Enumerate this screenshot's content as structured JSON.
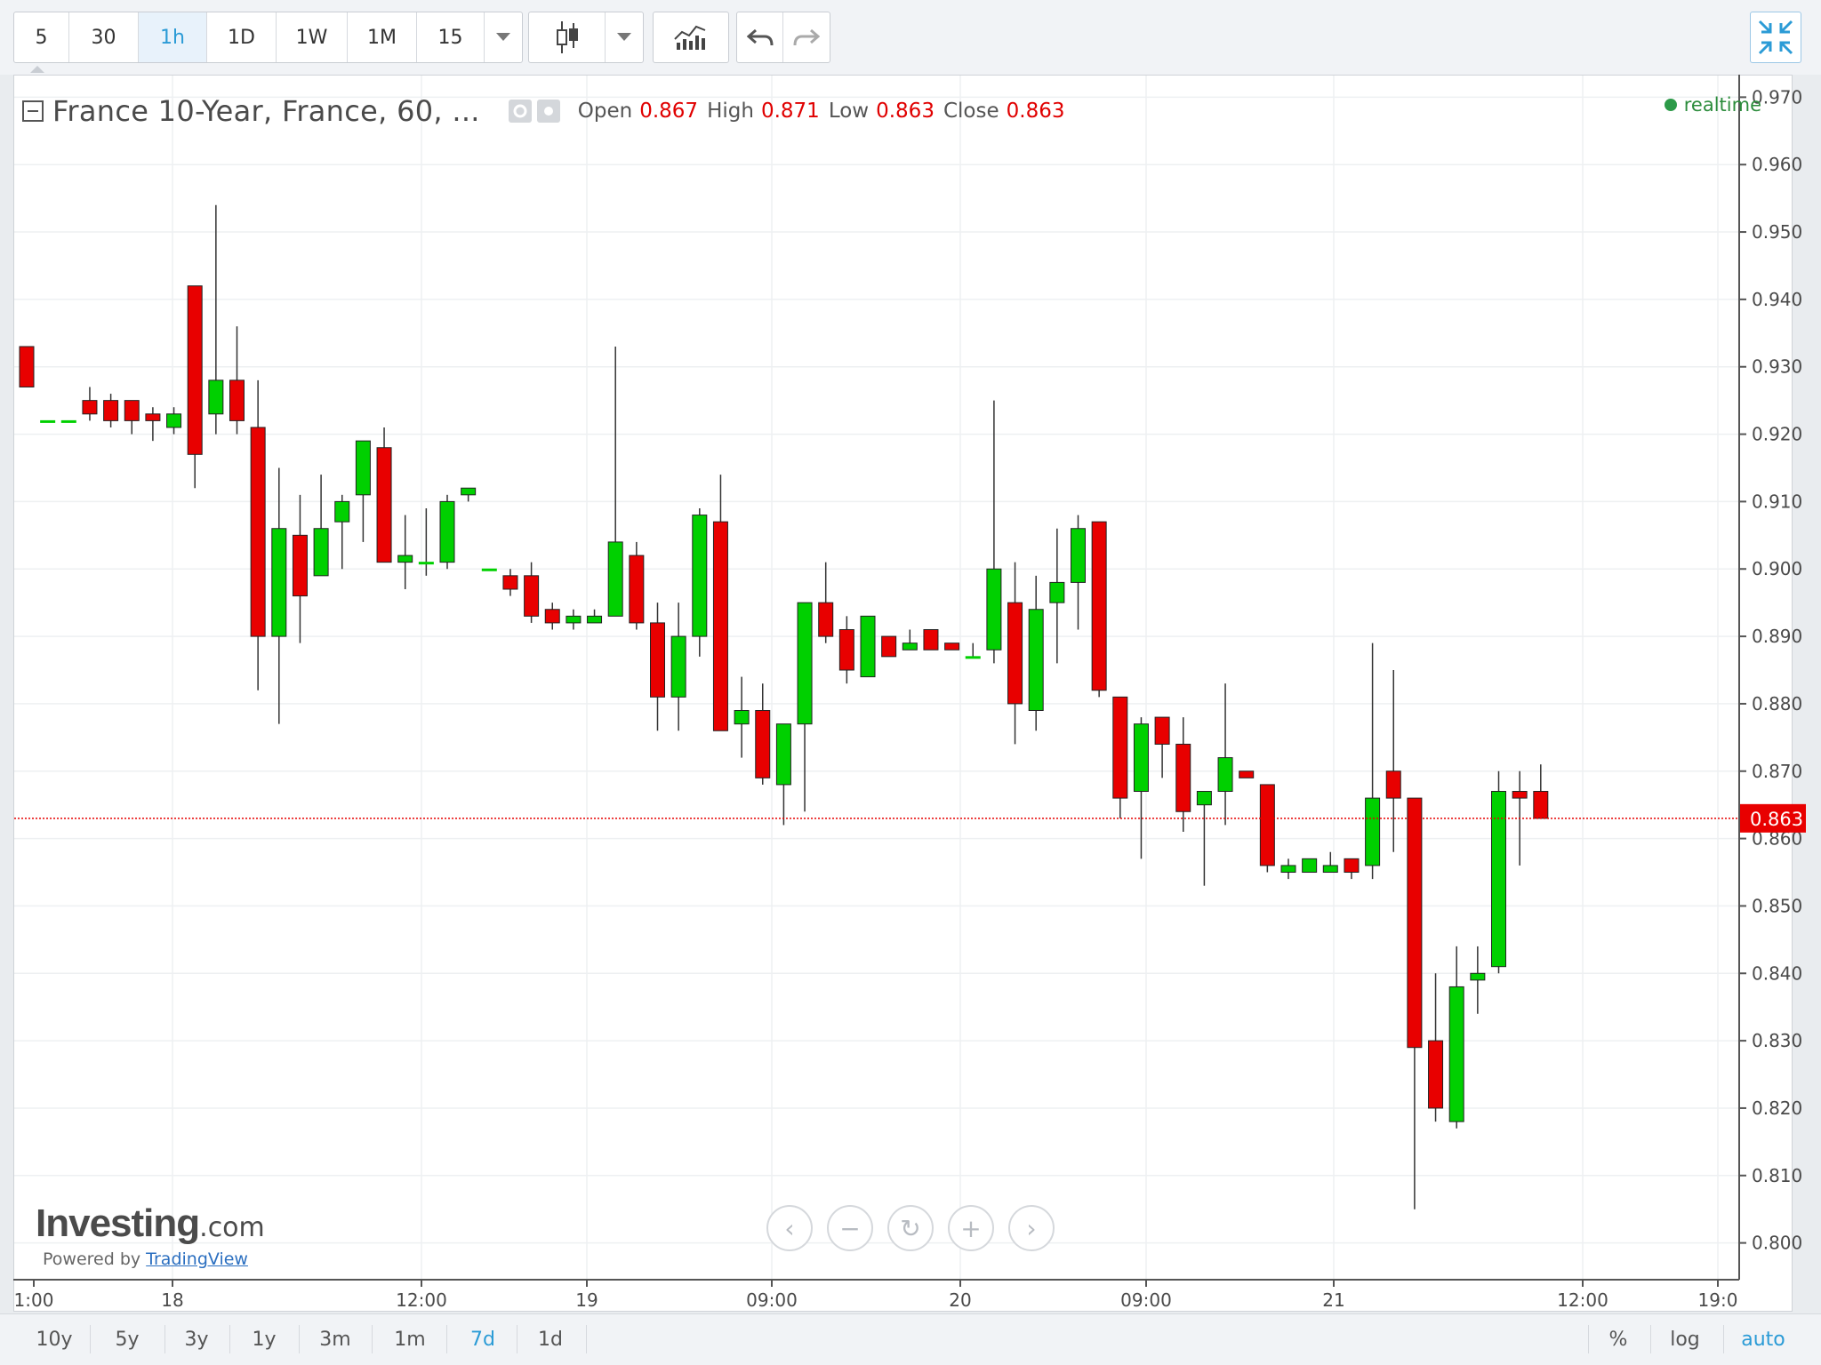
{
  "toolbar": {
    "intervals": [
      "5",
      "30",
      "1h",
      "1D",
      "1W",
      "1M",
      "15"
    ],
    "active_interval": "1h"
  },
  "header": {
    "title": "France 10-Year, France, 60, ...",
    "open_label": "Open",
    "open_value": "0.867",
    "high_label": "High",
    "high_value": "0.871",
    "low_label": "Low",
    "low_value": "0.863",
    "close_label": "Close",
    "close_value": "0.863",
    "realtime": "realtime"
  },
  "logo": {
    "brand": "Investing",
    "suffix": ".com",
    "powered_by": "Powered by",
    "powered_link": "TradingView"
  },
  "footer": {
    "ranges": [
      "10y",
      "5y",
      "3y",
      "1y",
      "3m",
      "1m",
      "7d",
      "1d"
    ],
    "active_range": "7d",
    "options": [
      "%",
      "log",
      "auto"
    ],
    "active_option": "auto"
  },
  "colors": {
    "up": "#00d000",
    "down": "#e80000",
    "last_price_line": "#e80000",
    "accent": "#2b9bd6"
  },
  "chart_data": {
    "type": "candlestick",
    "title": "France 10-Year, France, 60, ...",
    "last_price": 0.863,
    "ylim": [
      0.7975,
      0.972
    ],
    "y_ticks": [
      "0.970",
      "0.960",
      "0.950",
      "0.940",
      "0.930",
      "0.920",
      "0.910",
      "0.900",
      "0.890",
      "0.880",
      "0.870",
      "0.860",
      "0.850",
      "0.840",
      "0.830",
      "0.820",
      "0.810",
      "0.800"
    ],
    "x_ticks": [
      "1:00",
      "18",
      "12:00",
      "19",
      "09:00",
      "20",
      "09:00",
      "21",
      "12:00",
      "19:0"
    ],
    "grid": true,
    "candles": [
      {
        "o": 0.933,
        "h": 0.933,
        "l": 0.927,
        "c": 0.927
      },
      {
        "o": 0.922,
        "h": 0.922,
        "l": 0.922,
        "c": 0.922
      },
      {
        "o": 0.922,
        "h": 0.922,
        "l": 0.922,
        "c": 0.922
      },
      {
        "o": 0.925,
        "h": 0.927,
        "l": 0.922,
        "c": 0.923
      },
      {
        "o": 0.925,
        "h": 0.926,
        "l": 0.921,
        "c": 0.922
      },
      {
        "o": 0.925,
        "h": 0.925,
        "l": 0.92,
        "c": 0.922
      },
      {
        "o": 0.923,
        "h": 0.924,
        "l": 0.919,
        "c": 0.922
      },
      {
        "o": 0.921,
        "h": 0.924,
        "l": 0.92,
        "c": 0.923
      },
      {
        "o": 0.942,
        "h": 0.942,
        "l": 0.912,
        "c": 0.917
      },
      {
        "o": 0.923,
        "h": 0.954,
        "l": 0.92,
        "c": 0.928
      },
      {
        "o": 0.928,
        "h": 0.936,
        "l": 0.92,
        "c": 0.922
      },
      {
        "o": 0.921,
        "h": 0.928,
        "l": 0.882,
        "c": 0.89
      },
      {
        "o": 0.89,
        "h": 0.915,
        "l": 0.877,
        "c": 0.906
      },
      {
        "o": 0.905,
        "h": 0.911,
        "l": 0.889,
        "c": 0.896
      },
      {
        "o": 0.899,
        "h": 0.914,
        "l": 0.899,
        "c": 0.906
      },
      {
        "o": 0.907,
        "h": 0.911,
        "l": 0.9,
        "c": 0.91
      },
      {
        "o": 0.911,
        "h": 0.919,
        "l": 0.904,
        "c": 0.919
      },
      {
        "o": 0.918,
        "h": 0.921,
        "l": 0.901,
        "c": 0.901
      },
      {
        "o": 0.901,
        "h": 0.908,
        "l": 0.897,
        "c": 0.902
      },
      {
        "o": 0.901,
        "h": 0.909,
        "l": 0.899,
        "c": 0.901
      },
      {
        "o": 0.901,
        "h": 0.911,
        "l": 0.9,
        "c": 0.91
      },
      {
        "o": 0.911,
        "h": 0.912,
        "l": 0.91,
        "c": 0.912
      },
      {
        "o": 0.9,
        "h": 0.9,
        "l": 0.9,
        "c": 0.9
      },
      {
        "o": 0.899,
        "h": 0.9,
        "l": 0.896,
        "c": 0.897
      },
      {
        "o": 0.899,
        "h": 0.901,
        "l": 0.892,
        "c": 0.893
      },
      {
        "o": 0.894,
        "h": 0.895,
        "l": 0.891,
        "c": 0.892
      },
      {
        "o": 0.892,
        "h": 0.894,
        "l": 0.891,
        "c": 0.893
      },
      {
        "o": 0.892,
        "h": 0.894,
        "l": 0.892,
        "c": 0.893
      },
      {
        "o": 0.893,
        "h": 0.933,
        "l": 0.893,
        "c": 0.904
      },
      {
        "o": 0.902,
        "h": 0.904,
        "l": 0.891,
        "c": 0.892
      },
      {
        "o": 0.892,
        "h": 0.895,
        "l": 0.876,
        "c": 0.881
      },
      {
        "o": 0.881,
        "h": 0.895,
        "l": 0.876,
        "c": 0.89
      },
      {
        "o": 0.89,
        "h": 0.909,
        "l": 0.887,
        "c": 0.908
      },
      {
        "o": 0.907,
        "h": 0.914,
        "l": 0.876,
        "c": 0.876
      },
      {
        "o": 0.877,
        "h": 0.884,
        "l": 0.872,
        "c": 0.879
      },
      {
        "o": 0.879,
        "h": 0.883,
        "l": 0.868,
        "c": 0.869
      },
      {
        "o": 0.868,
        "h": 0.877,
        "l": 0.862,
        "c": 0.877
      },
      {
        "o": 0.877,
        "h": 0.895,
        "l": 0.864,
        "c": 0.895
      },
      {
        "o": 0.895,
        "h": 0.901,
        "l": 0.889,
        "c": 0.89
      },
      {
        "o": 0.891,
        "h": 0.893,
        "l": 0.883,
        "c": 0.885
      },
      {
        "o": 0.884,
        "h": 0.893,
        "l": 0.884,
        "c": 0.893
      },
      {
        "o": 0.89,
        "h": 0.89,
        "l": 0.887,
        "c": 0.887
      },
      {
        "o": 0.888,
        "h": 0.891,
        "l": 0.888,
        "c": 0.889
      },
      {
        "o": 0.891,
        "h": 0.891,
        "l": 0.888,
        "c": 0.888
      },
      {
        "o": 0.889,
        "h": 0.889,
        "l": 0.888,
        "c": 0.888
      },
      {
        "o": 0.887,
        "h": 0.889,
        "l": 0.887,
        "c": 0.887
      },
      {
        "o": 0.888,
        "h": 0.925,
        "l": 0.886,
        "c": 0.9
      },
      {
        "o": 0.895,
        "h": 0.901,
        "l": 0.874,
        "c": 0.88
      },
      {
        "o": 0.879,
        "h": 0.899,
        "l": 0.876,
        "c": 0.894
      },
      {
        "o": 0.895,
        "h": 0.906,
        "l": 0.886,
        "c": 0.898
      },
      {
        "o": 0.898,
        "h": 0.908,
        "l": 0.891,
        "c": 0.906
      },
      {
        "o": 0.907,
        "h": 0.907,
        "l": 0.881,
        "c": 0.882
      },
      {
        "o": 0.881,
        "h": 0.881,
        "l": 0.863,
        "c": 0.866
      },
      {
        "o": 0.867,
        "h": 0.878,
        "l": 0.857,
        "c": 0.877
      },
      {
        "o": 0.878,
        "h": 0.878,
        "l": 0.869,
        "c": 0.874
      },
      {
        "o": 0.874,
        "h": 0.878,
        "l": 0.861,
        "c": 0.864
      },
      {
        "o": 0.865,
        "h": 0.867,
        "l": 0.853,
        "c": 0.867
      },
      {
        "o": 0.867,
        "h": 0.883,
        "l": 0.862,
        "c": 0.872
      },
      {
        "o": 0.87,
        "h": 0.87,
        "l": 0.869,
        "c": 0.869
      },
      {
        "o": 0.868,
        "h": 0.868,
        "l": 0.855,
        "c": 0.856
      },
      {
        "o": 0.855,
        "h": 0.857,
        "l": 0.854,
        "c": 0.856
      },
      {
        "o": 0.855,
        "h": 0.857,
        "l": 0.855,
        "c": 0.857
      },
      {
        "o": 0.855,
        "h": 0.858,
        "l": 0.855,
        "c": 0.856
      },
      {
        "o": 0.857,
        "h": 0.857,
        "l": 0.854,
        "c": 0.855
      },
      {
        "o": 0.856,
        "h": 0.889,
        "l": 0.854,
        "c": 0.866
      },
      {
        "o": 0.87,
        "h": 0.885,
        "l": 0.858,
        "c": 0.866
      },
      {
        "o": 0.866,
        "h": 0.866,
        "l": 0.805,
        "c": 0.829
      },
      {
        "o": 0.83,
        "h": 0.84,
        "l": 0.818,
        "c": 0.82
      },
      {
        "o": 0.818,
        "h": 0.844,
        "l": 0.817,
        "c": 0.838
      },
      {
        "o": 0.839,
        "h": 0.844,
        "l": 0.834,
        "c": 0.84
      },
      {
        "o": 0.841,
        "h": 0.87,
        "l": 0.84,
        "c": 0.867
      },
      {
        "o": 0.867,
        "h": 0.87,
        "l": 0.856,
        "c": 0.866
      },
      {
        "o": 0.867,
        "h": 0.871,
        "l": 0.863,
        "c": 0.863
      }
    ]
  }
}
